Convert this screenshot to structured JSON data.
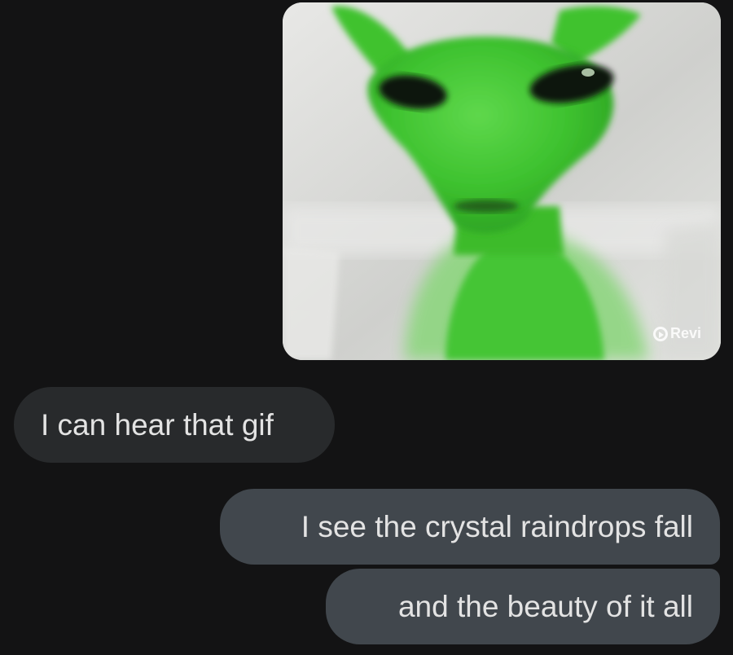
{
  "conversation": {
    "gif": {
      "alt": "green alien gif",
      "watermark": "Revi"
    },
    "messages": [
      {
        "direction": "incoming",
        "text": "I can hear that gif"
      },
      {
        "direction": "outgoing",
        "text": "I see the crystal raindrops fall"
      },
      {
        "direction": "outgoing",
        "text": "and the beauty of it all"
      }
    ]
  },
  "colors": {
    "background": "#131314",
    "incoming_bubble": "#282a2c",
    "outgoing_bubble": "#41474d",
    "text": "#e3e3e3",
    "alien_green": "#3ec22f"
  }
}
